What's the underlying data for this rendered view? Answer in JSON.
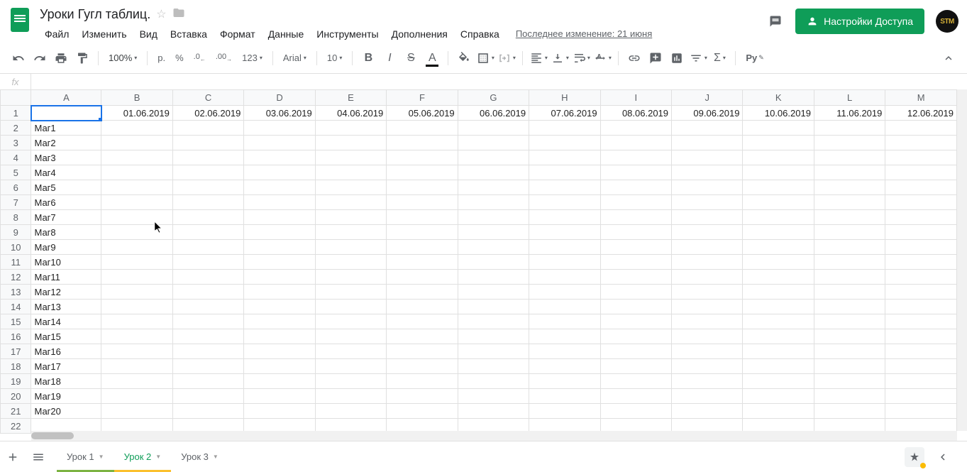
{
  "doc": {
    "title": "Уроки Гугл таблиц.",
    "last_edit": "Последнее изменение: 21 июня"
  },
  "menus": [
    "Файл",
    "Изменить",
    "Вид",
    "Вставка",
    "Формат",
    "Данные",
    "Инструменты",
    "Дополнения",
    "Справка"
  ],
  "share_label": "Настройки Доступа",
  "avatar_text": "STM",
  "toolbar": {
    "zoom": "100%",
    "currency": "р.",
    "percent": "%",
    "dec_dec": ".0",
    "dec_inc": ".00",
    "more_formats": "123",
    "font": "Arial",
    "font_size": "10"
  },
  "fx_label": "fx",
  "fx_value": "",
  "columns": [
    "A",
    "B",
    "C",
    "D",
    "E",
    "F",
    "G",
    "H",
    "I",
    "J",
    "K",
    "L",
    "M"
  ],
  "row_count": 22,
  "selected_cell": "A1",
  "dates": [
    "01.06.2019",
    "02.06.2019",
    "03.06.2019",
    "04.06.2019",
    "05.06.2019",
    "06.06.2019",
    "07.06.2019",
    "08.06.2019",
    "09.06.2019",
    "10.06.2019",
    "11.06.2019",
    "12.06.2019"
  ],
  "marks": [
    "Маг1",
    "Маг2",
    "Маг3",
    "Маг4",
    "Маг5",
    "Маг6",
    "Маг7",
    "Маг8",
    "Маг9",
    "Маг10",
    "Маг11",
    "Маг12",
    "Маг13",
    "Маг14",
    "Маг15",
    "Маг16",
    "Маг17",
    "Маг18",
    "Маг19",
    "Маг20"
  ],
  "sheets": [
    {
      "name": "Урок 1",
      "active": false
    },
    {
      "name": "Урок 2",
      "active": true
    },
    {
      "name": "Урок 3",
      "active": false
    }
  ]
}
